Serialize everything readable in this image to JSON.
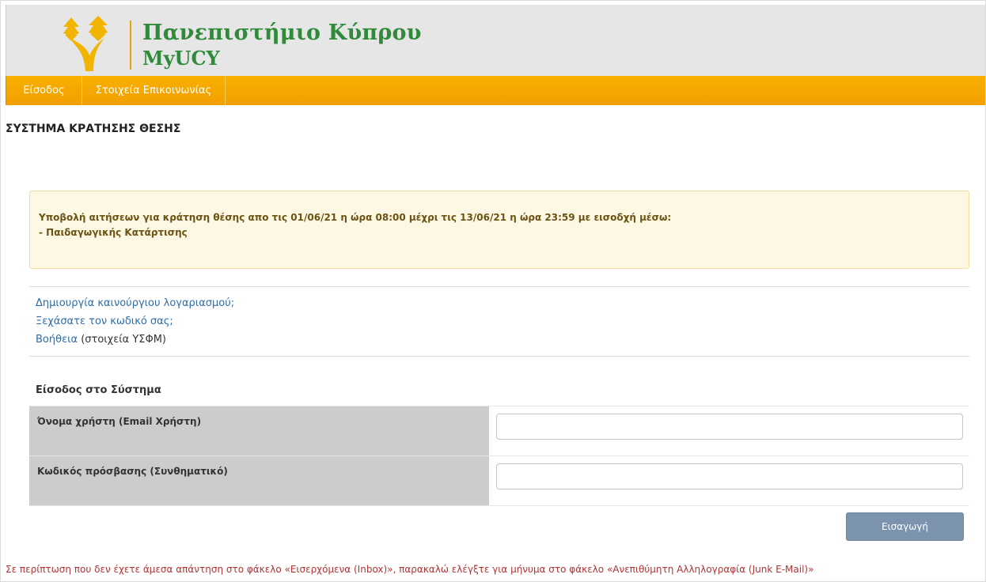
{
  "header": {
    "logo_title": "Πανεπιστήμιο Κύπρου",
    "logo_subtitle": "MyUCY",
    "logo_icon": "cypress-tree-logo-icon",
    "colors": {
      "logo_green": "#2f8a3a",
      "logo_gold": "#f1b400"
    }
  },
  "nav": {
    "items": [
      {
        "label": "Είσοδος"
      },
      {
        "label": "Στοιχεία Επικοινωνίας"
      }
    ],
    "color": "#f5a800"
  },
  "page_title": "ΣΥΣΤΗΜΑ ΚΡΑΤΗΣΗΣ ΘΕΣΗΣ",
  "notice": {
    "line1": "Υποβολή αιτήσεων για κράτηση θέσης απο τις 01/06/21 η ώρα 08:00 μέχρι τις 13/06/21 η ώρα 23:59 με εισοδχή μέσω:",
    "line2": "- Παιδαγωγικής Κατάρτισης"
  },
  "links": {
    "create_account": "Δημιουργία καινούργιου λογαριασμού;",
    "forgot_password": "Ξεχάσατε τον κωδικό σας;",
    "help": "Βοήθεια",
    "help_suffix": " (στοιχεία ΥΣΦΜ)"
  },
  "login": {
    "section_title": "Είσοδος στο Σύστημα",
    "username_label": "Όνομα χρήστη (Email Χρήστη)",
    "username_value": "",
    "password_label": "Κωδικός πρόσβασης (Συνθηματικό)",
    "password_value": "",
    "submit_label": "Εισαγωγή"
  },
  "footer_note": "Σε περίπτωση που δεν έχετε άμεσα απάντηση στο φάκελο «Εισερχόμενα (Inbox)», παρακαλώ ελέγξτε για μήνυμα στο φάκελο «Ανεπιθύμητη Αλληλογραφία (Junk E-Mail)»"
}
